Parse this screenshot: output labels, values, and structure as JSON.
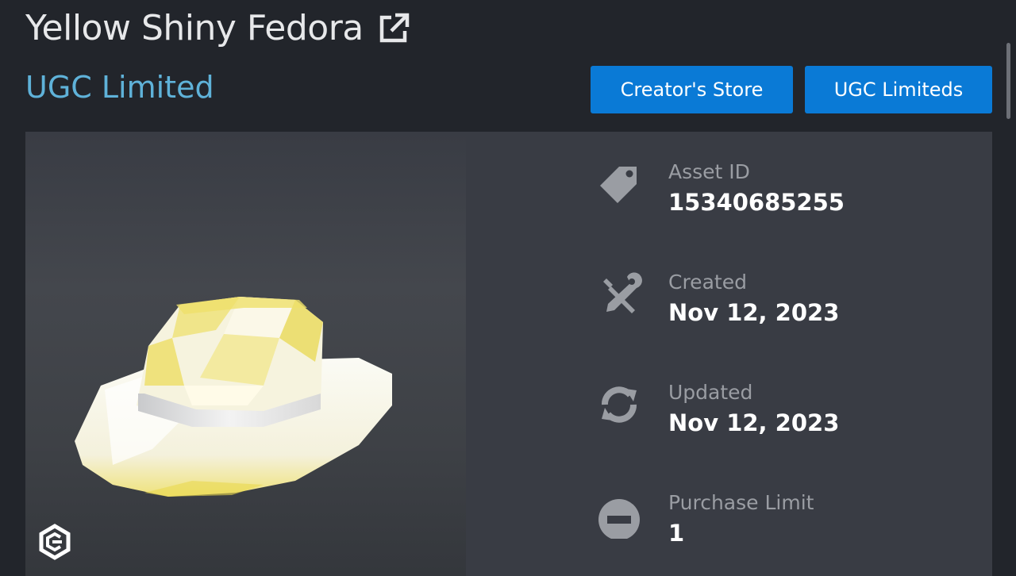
{
  "item": {
    "title": "Yellow Shiny Fedora",
    "type": "UGC Limited"
  },
  "header": {
    "external_link_icon": "external-link-icon"
  },
  "buttons": {
    "creators_store": "Creator's Store",
    "ugc_limiteds": "UGC Limiteds"
  },
  "details": [
    {
      "label": "Asset ID",
      "value": "15340685255",
      "icon": "price-tag-icon"
    },
    {
      "label": "Created",
      "value": "Nov 12, 2023",
      "icon": "tools-icon"
    },
    {
      "label": "Updated",
      "value": "Nov 12, 2023",
      "icon": "refresh-icon"
    },
    {
      "label": "Purchase Limit",
      "value": "1",
      "icon": "no-entry-icon"
    }
  ],
  "colors": {
    "background": "#22252b",
    "card": "#393c44",
    "accent_link": "#5fb2d9",
    "button": "#0a7ad6"
  }
}
